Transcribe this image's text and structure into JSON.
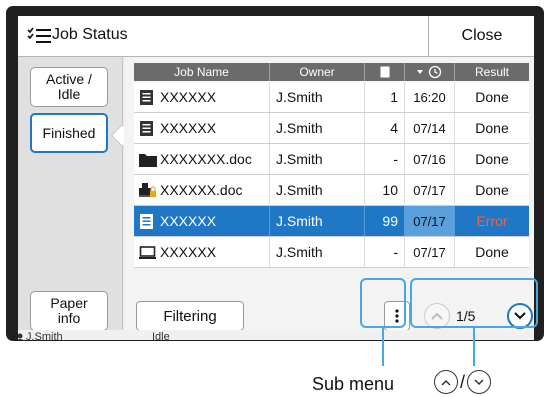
{
  "window": {
    "title": "Job Status",
    "close_label": "Close"
  },
  "sidebar": {
    "items": [
      {
        "label": "Active /\nIdle"
      },
      {
        "label": "Finished"
      },
      {
        "label": "Paper\ninfo"
      }
    ]
  },
  "table": {
    "headers": [
      "Job Name",
      "Owner",
      "",
      "",
      "Result"
    ],
    "rows": [
      {
        "icon": "document-icon",
        "name": "XXXXXX",
        "owner": "J.Smith",
        "pages": "1",
        "date": "16:20",
        "result": "Done",
        "selected": false
      },
      {
        "icon": "document-icon",
        "name": "XXXXXX",
        "owner": "J.Smith",
        "pages": "4",
        "date": "07/14",
        "result": "Done",
        "selected": false
      },
      {
        "icon": "folder-icon",
        "name": "XXXXXXX.doc",
        "owner": "J.Smith",
        "pages": "-",
        "date": "07/16",
        "result": "Done",
        "selected": false
      },
      {
        "icon": "locked-printer-icon",
        "name": "XXXXXX.doc",
        "owner": "J.Smith",
        "pages": "10",
        "date": "07/17",
        "result": "Done",
        "selected": false
      },
      {
        "icon": "document-icon",
        "name": "XXXXXX",
        "owner": "J.Smith",
        "pages": "99",
        "date": "07/17",
        "result": "Error",
        "selected": true
      },
      {
        "icon": "monitor-icon",
        "name": "XXXXXX",
        "owner": "J.Smith",
        "pages": "-",
        "date": "07/17",
        "result": "Done",
        "selected": false
      }
    ]
  },
  "toolbar": {
    "filter_label": "Filtering",
    "page_indicator": "1/5"
  },
  "statusbar": {
    "user": "J.Smith",
    "status": "Idle"
  },
  "annotations": {
    "sub_menu": "Sub menu",
    "separator": "/"
  },
  "colors": {
    "accent": "#1f77c6",
    "callout": "#4aa5e0",
    "error": "#ff5c3a"
  }
}
